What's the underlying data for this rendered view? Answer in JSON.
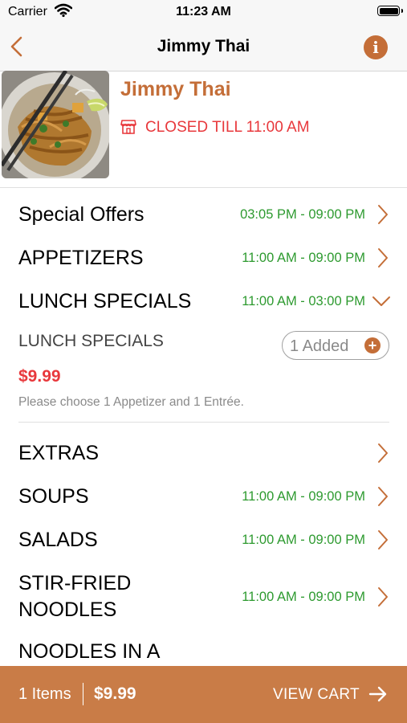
{
  "status_bar": {
    "carrier": "Carrier",
    "time": "11:23 AM"
  },
  "nav": {
    "title": "Jimmy Thai"
  },
  "restaurant": {
    "name": "Jimmy Thai",
    "status": "CLOSED TILL 11:00 AM"
  },
  "categories": [
    {
      "name": "Special Offers",
      "hours": "03:05 PM - 09:00 PM"
    },
    {
      "name": "APPETIZERS",
      "hours": "11:00 AM - 09:00 PM"
    },
    {
      "name": "LUNCH SPECIALS",
      "hours": "11:00 AM - 03:00 PM"
    },
    {
      "name": "EXTRAS",
      "hours": ""
    },
    {
      "name": "SOUPS",
      "hours": "11:00 AM - 09:00 PM"
    },
    {
      "name": "SALADS",
      "hours": "11:00 AM - 09:00 PM"
    },
    {
      "name": "STIR-FRIED",
      "name_line2": "NOODLES",
      "hours": "11:00 AM - 09:00 PM"
    },
    {
      "name": "NOODLES IN A"
    }
  ],
  "expanded_item": {
    "name": "LUNCH SPECIALS",
    "added_label": "1 Added",
    "price": "$9.99",
    "description": "Please choose 1 Appetizer and 1 Entrée."
  },
  "cart": {
    "items": "1 Items",
    "total": "$9.99",
    "view_label": "VIEW CART"
  },
  "colors": {
    "accent": "#c46e38",
    "closed": "#e8383c",
    "hours": "#2d9a2f",
    "cart_bar": "#c97c47"
  },
  "icons": [
    "back-chevron-icon",
    "info-icon",
    "store-icon",
    "chevron-right-icon",
    "chevron-down-icon",
    "plus-icon",
    "arrow-right-icon"
  ]
}
